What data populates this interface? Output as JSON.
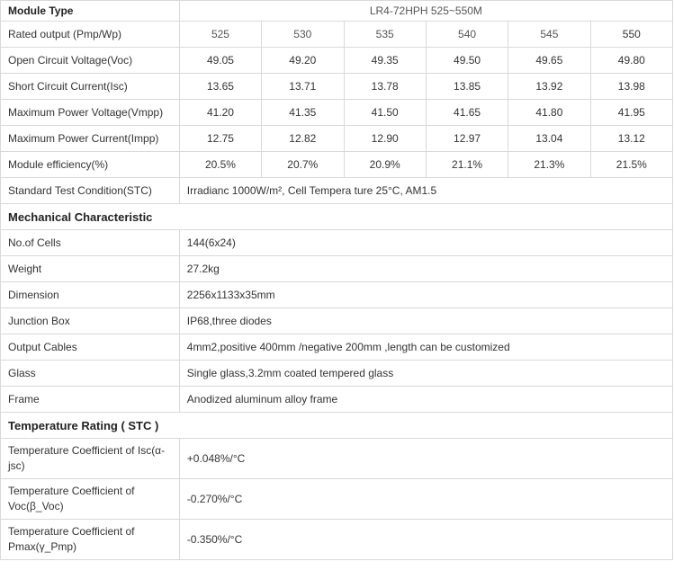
{
  "header": {
    "label": "Module Type",
    "model": "LR4-72HPH 525~550M"
  },
  "electrical": {
    "rows": [
      {
        "label": "Rated output (Pmp/Wp)",
        "values": [
          "525",
          "530",
          "535",
          "540",
          "545",
          "550"
        ]
      },
      {
        "label": "Open Circuit Voltage(Voc)",
        "values": [
          "49.05",
          "49.20",
          "49.35",
          "49.50",
          "49.65",
          "49.80"
        ]
      },
      {
        "label": "Short Circuit Current(Isc)",
        "values": [
          "13.65",
          "13.71",
          "13.78",
          "13.85",
          "13.92",
          "13.98"
        ]
      },
      {
        "label": "Maximum Power Voltage(Vmpp)",
        "values": [
          "41.20",
          "41.35",
          "41.50",
          "41.65",
          "41.80",
          "41.95"
        ]
      },
      {
        "label": "Maximum Power Current(Impp)",
        "values": [
          "12.75",
          "12.82",
          "12.90",
          "12.97",
          "13.04",
          "13.12"
        ]
      },
      {
        "label": "Module efficiency(%)",
        "values": [
          "20.5%",
          "20.7%",
          "20.9%",
          "21.1%",
          "21.3%",
          "21.5%"
        ]
      }
    ],
    "stc": {
      "label": "Standard Test Condition(STC)",
      "value": "Irradianc 1000W/m², Cell Tempera ture 25°C, AM1.5"
    }
  },
  "mechanical": {
    "title": "Mechanical Characteristic",
    "rows": [
      {
        "label": "No.of Cells",
        "value": "144(6x24)"
      },
      {
        "label": "Weight",
        "value": "27.2kg"
      },
      {
        "label": "Dimension",
        "value": "2256x1133x35mm"
      },
      {
        "label": "Junction Box",
        "value": "IP68,three diodes"
      },
      {
        "label": "Output Cables",
        "value": "4mm2,positive 400mm /negative 200mm ,length can be customized"
      },
      {
        "label": "Glass",
        "value": "Single glass,3.2mm coated tempered glass"
      },
      {
        "label": "Frame",
        "value": "Anodized aluminum alloy frame"
      }
    ]
  },
  "temperature": {
    "title": "Temperature Rating ( STC )",
    "rows": [
      {
        "label1": "Temperature Coefficient of Isc(α-",
        "label2": "jsc)",
        "value": "+0.048%/°C"
      },
      {
        "label1": "Temperature Coefficient of",
        "label2": "Voc(β_Voc)",
        "value": "-0.270%/°C"
      },
      {
        "label1": "Temperature Coefficient of",
        "label2": "Pmax(γ_Pmp)",
        "value": "-0.350%/°C"
      }
    ]
  }
}
